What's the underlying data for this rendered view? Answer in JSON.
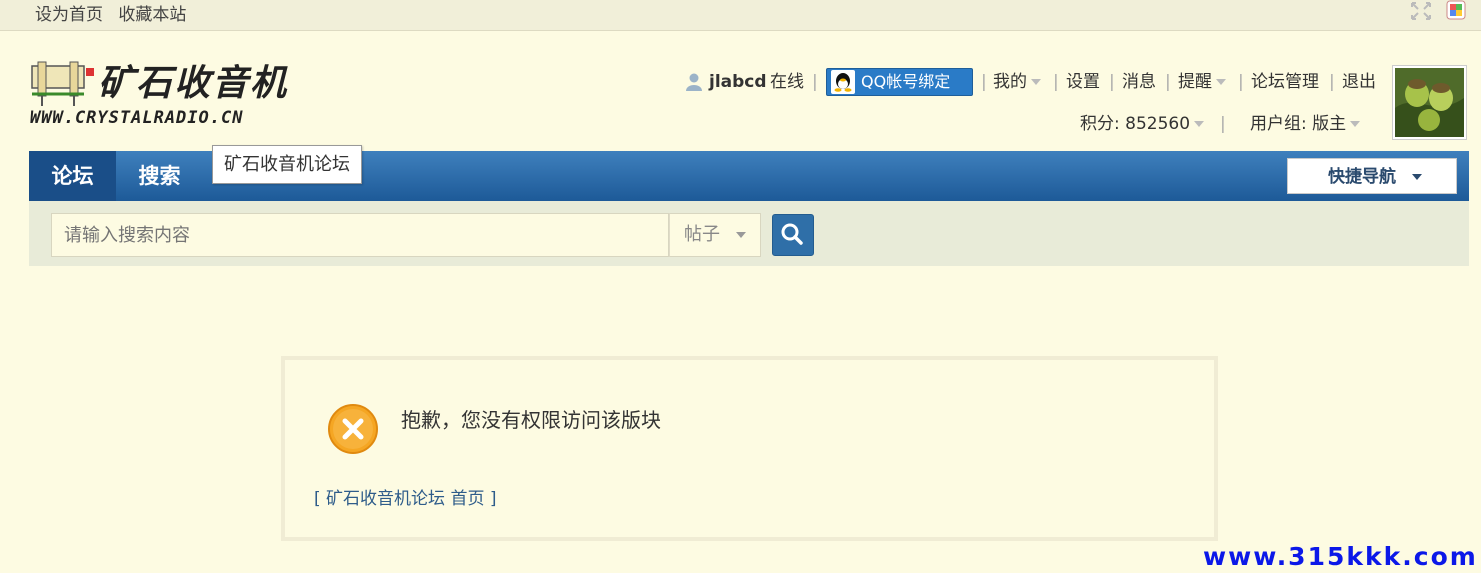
{
  "topbar": {
    "set_home": "设为首页",
    "bookmark": "收藏本站"
  },
  "logo": {
    "cn": "矿石收音机",
    "en": "WWW.CRYSTALRADIO.CN"
  },
  "user": {
    "username": "jlabcd",
    "status": "在线",
    "qq_bind": "QQ帐号绑定",
    "mine": "我的",
    "settings": "设置",
    "messages": "消息",
    "reminders": "提醒",
    "forum_admin": "论坛管理",
    "logout": "退出",
    "points_label": "积分: 852560",
    "group_label": "用户组: 版主"
  },
  "nav": {
    "forum": "论坛",
    "search": "搜索",
    "tooltip": "矿石收音机论坛",
    "quick_nav": "快捷导航"
  },
  "search": {
    "placeholder": "请输入搜索内容",
    "type": "帖子"
  },
  "message": {
    "text": "抱歉，您没有权限访问该版块",
    "back_link": "[ 矿石收音机论坛 首页 ]"
  },
  "watermark": "www.315kkk.com",
  "colors": {
    "accent": "#2a7bc7",
    "nav_bg": "#1d5a98",
    "error_orange": "#f5a623",
    "page_bg": "#fdfbe2"
  }
}
